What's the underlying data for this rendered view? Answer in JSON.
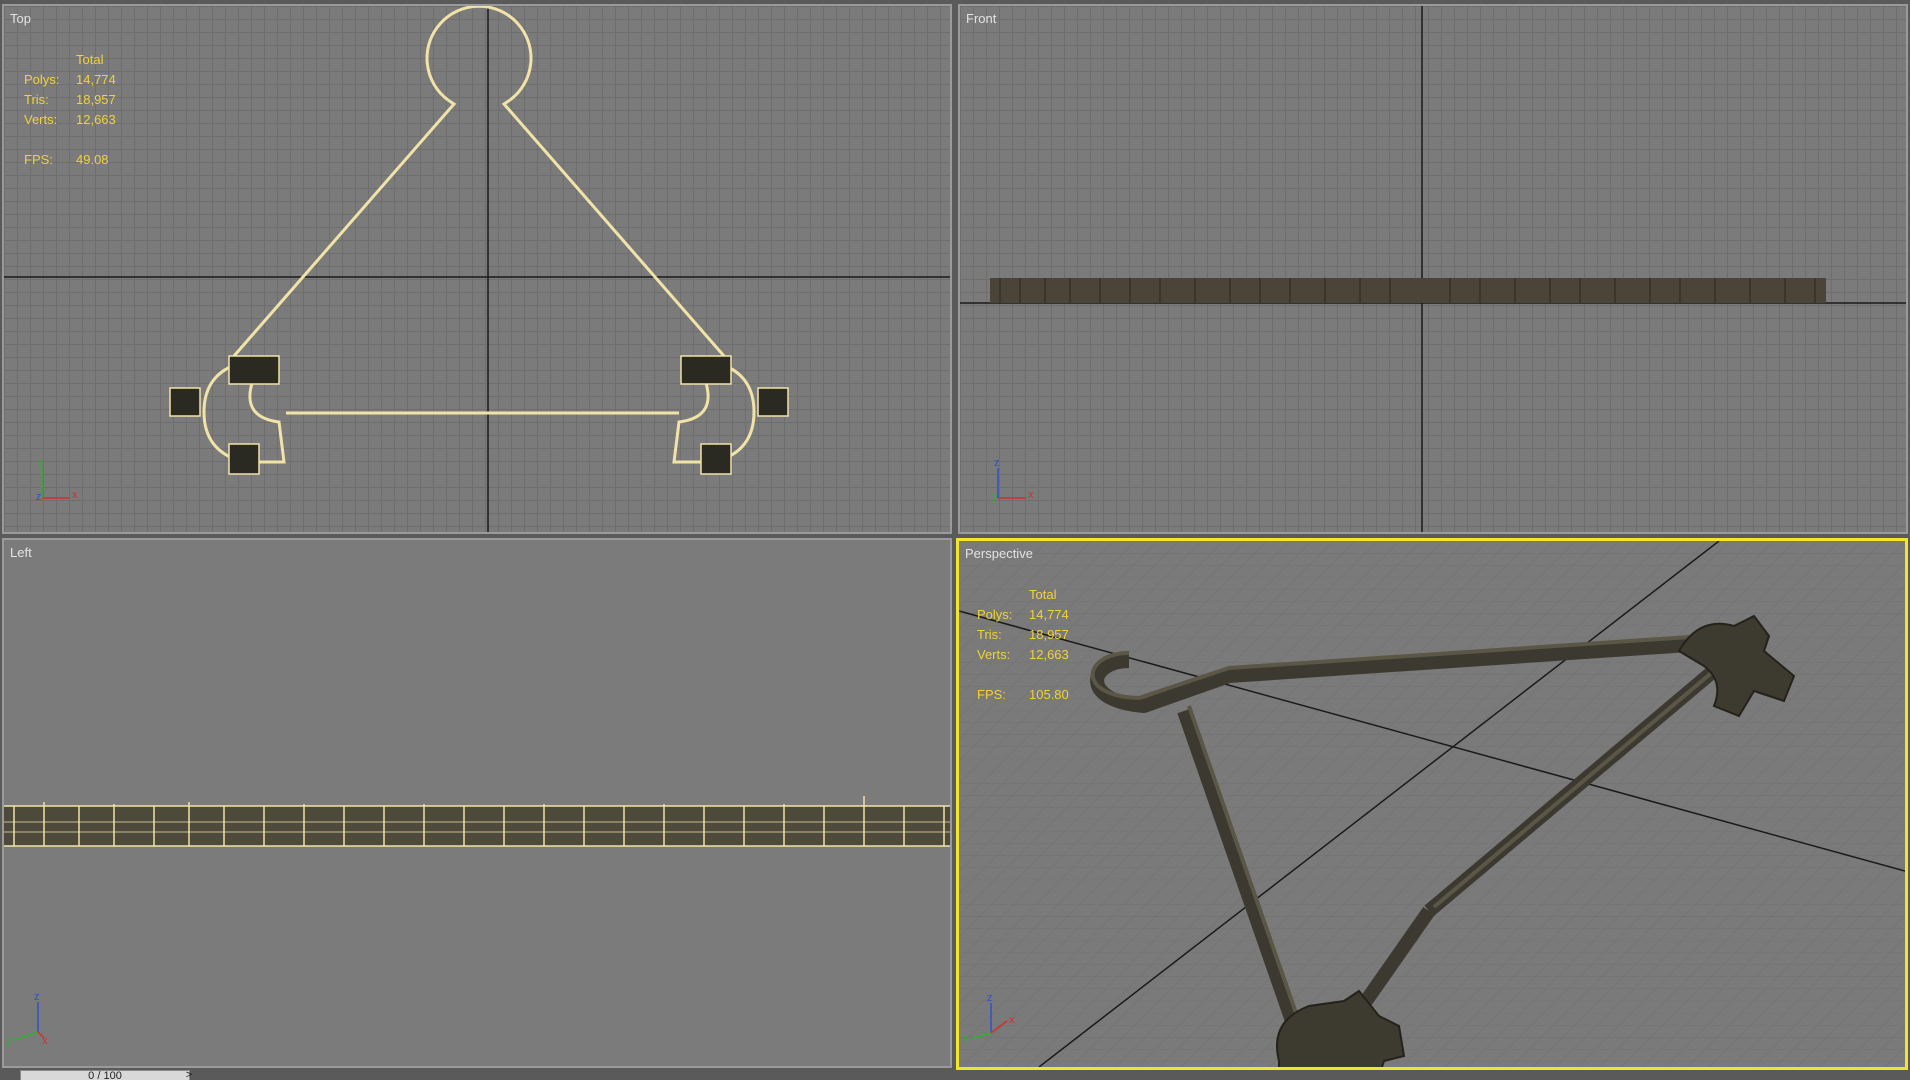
{
  "viewports": {
    "top": {
      "label": "Top"
    },
    "front": {
      "label": "Front"
    },
    "left": {
      "label": "Left"
    },
    "perspective": {
      "label": "Perspective"
    }
  },
  "stats_top": {
    "header": "Total",
    "polys_label": "Polys:",
    "polys_value": "14,774",
    "tris_label": "Tris:",
    "tris_value": "18,957",
    "verts_label": "Verts:",
    "verts_value": "12,663",
    "fps_label": "FPS:",
    "fps_value": "49.08"
  },
  "stats_persp": {
    "header": "Total",
    "polys_label": "Polys:",
    "polys_value": "14,774",
    "tris_label": "Tris:",
    "tris_value": "18,957",
    "verts_label": "Verts:",
    "verts_value": "12,663",
    "fps_label": "FPS:",
    "fps_value": "105.80"
  },
  "axes": {
    "x": "x",
    "y": "y",
    "z": "z"
  },
  "timeline": {
    "frame": "0 / 100",
    "next": ">"
  },
  "colors": {
    "active_border": "#f2e52a",
    "wire": "#f1e3a8",
    "stats": "#f0d23a",
    "axis_x": "#d03030",
    "axis_y": "#30b030",
    "axis_z": "#3050d0"
  }
}
